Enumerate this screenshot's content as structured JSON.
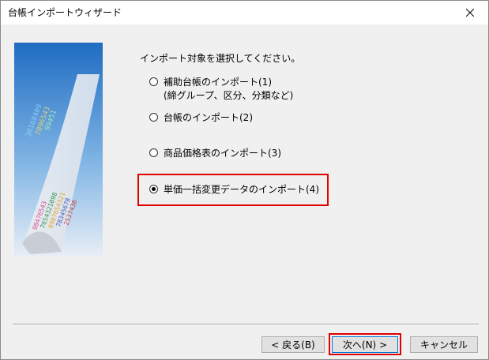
{
  "window": {
    "title": "台帳インポートウィザード"
  },
  "instruction": "インポート対象を選択してください。",
  "options": [
    {
      "label": "補助台帳のインポート(1)",
      "sublabel": "(締グループ、区分、分類など)",
      "checked": false
    },
    {
      "label": "台帳のインポート(2)",
      "checked": false
    },
    {
      "label": "商品価格表のインポート(3)",
      "checked": false
    },
    {
      "label": "単価一括変更データのインポート(4)",
      "checked": true
    }
  ],
  "buttons": {
    "back": "< 戻る(B)",
    "next": "次へ(N) >",
    "cancel": "キャンセル"
  },
  "colors": {
    "highlight": "#e00000",
    "graphic_sky": "#1f6cc1"
  }
}
